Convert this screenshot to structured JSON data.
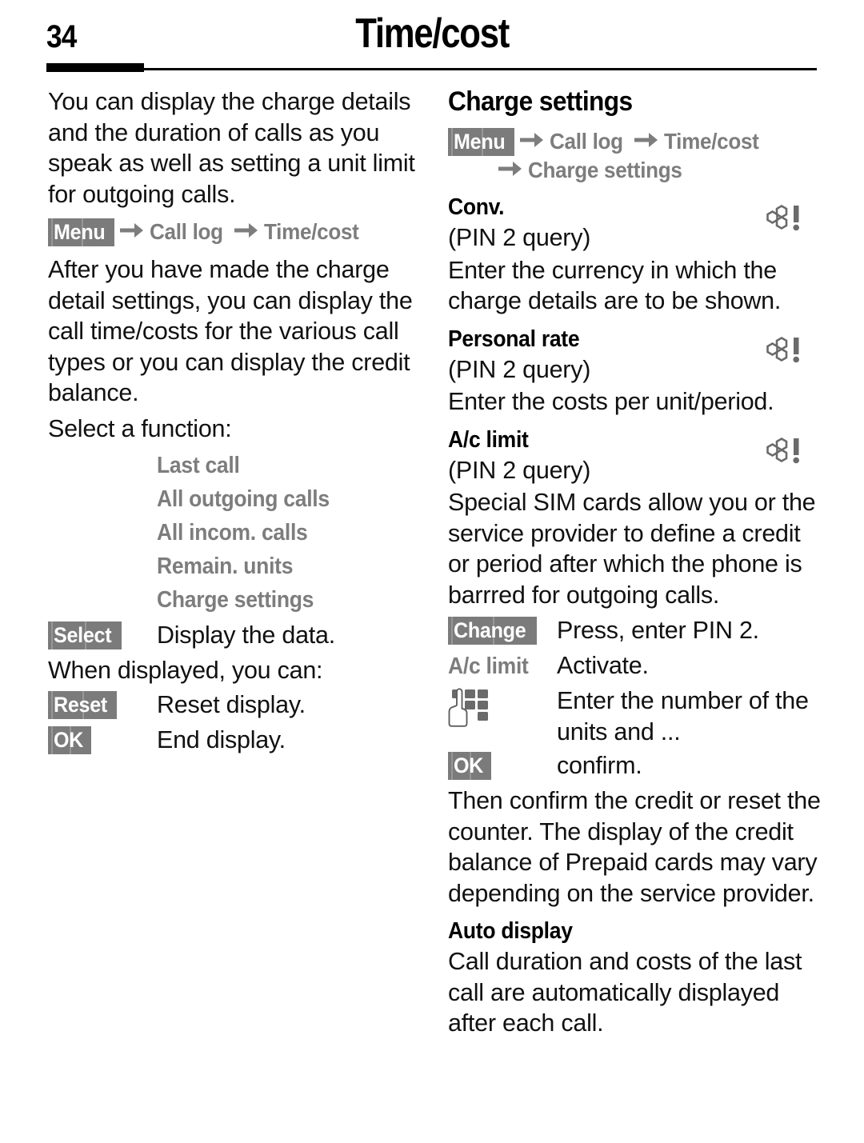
{
  "header": {
    "page_number": "34",
    "title": "Time/cost"
  },
  "left_column": {
    "intro_paragraph": "You can display the charge details and the duration of calls as you speak as well as setting a unit limit for outgoing calls.",
    "navpath": {
      "menu_label": "Menu",
      "step1": "Call log",
      "step2": "Time/cost"
    },
    "after_paragraph": "After you have made the charge detail settings, you can display the call time/costs for the various call types or you can display the credit balance.",
    "select_function_label": "Select a function:",
    "options": [
      "Last call",
      "All outgoing calls",
      "All incom. calls",
      "Remain. units",
      "Charge settings"
    ],
    "rows": [
      {
        "key": "Select",
        "key_type": "softkey",
        "desc": "Display the data."
      }
    ],
    "when_displayed_label": "When displayed, you can:",
    "rows2": [
      {
        "key": "Reset",
        "key_type": "softkey",
        "desc": "Reset display."
      },
      {
        "key": "OK",
        "key_type": "softkey",
        "desc": "End display."
      }
    ]
  },
  "right_column": {
    "section_heading": "Charge settings",
    "navpath": {
      "menu_label": "Menu",
      "step1": "Call log",
      "step2": "Time/cost",
      "step3": "Charge settings"
    },
    "conv": {
      "heading": "Conv.",
      "pin_note": "(PIN 2 query)",
      "body": "Enter the currency in which the charge details are to be shown.",
      "icon": "sim-card-dependent-icon"
    },
    "personal_rate": {
      "heading": "Personal rate",
      "pin_note": "(PIN 2 query)",
      "body": "Enter the costs per unit/period.",
      "icon": "sim-card-dependent-icon"
    },
    "ac_limit": {
      "heading": "A/c limit",
      "pin_note": "(PIN 2 query)",
      "body": "Special SIM cards allow you or the service provider to define a credit or period after which the phone is barrred for outgoing calls.",
      "icon": "sim-card-dependent-icon",
      "rows": [
        {
          "key": "Change",
          "key_type": "softkey",
          "desc": "Press, enter PIN 2."
        },
        {
          "key": "A/c limit",
          "key_type": "gray-label",
          "desc": "Activate."
        },
        {
          "key": "keypad-entry-icon",
          "key_type": "icon",
          "desc": "Enter the number of the units and ..."
        },
        {
          "key": "OK",
          "key_type": "softkey",
          "desc": "confirm."
        }
      ],
      "closing": "Then confirm the credit or reset the counter. The display of the credit balance of Prepaid cards may vary depending on the service provider."
    },
    "auto_display": {
      "heading": "Auto display",
      "body": "Call duration and costs of the last call are automatically displayed after each call."
    }
  },
  "colors": {
    "gray_text": "#7d7d7d",
    "softkey_bg": "#7b7b7b",
    "body_text": "#111111",
    "icon_gray": "#6a6a6a"
  }
}
